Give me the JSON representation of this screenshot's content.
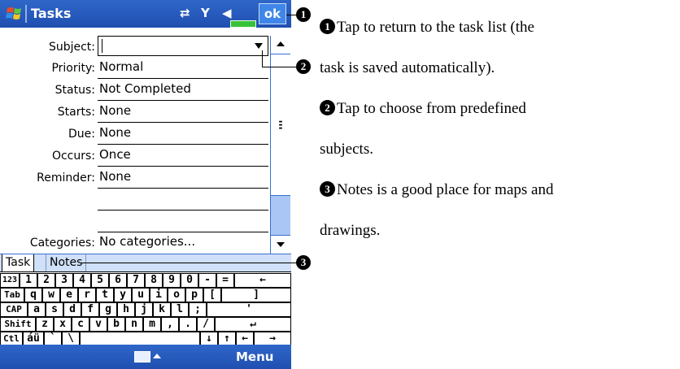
{
  "titlebar": {
    "title": "Tasks",
    "icons": [
      "connectivity-icon",
      "signal-icon",
      "speaker-icon"
    ],
    "ok_label": "ok"
  },
  "form": {
    "fields": [
      {
        "label": "Subject:",
        "value": ""
      },
      {
        "label": "Priority:",
        "value": "Normal"
      },
      {
        "label": "Status:",
        "value": "Not Completed"
      },
      {
        "label": "Starts:",
        "value": "None"
      },
      {
        "label": "Due:",
        "value": "None"
      },
      {
        "label": "Occurs:",
        "value": "Once"
      },
      {
        "label": "Reminder:",
        "value": "None"
      },
      {
        "label": "",
        "value": ""
      },
      {
        "label": "Categories:",
        "value": "No categories..."
      }
    ]
  },
  "tabs": [
    "Task",
    "Notes"
  ],
  "keyboard": {
    "rows": [
      [
        "123",
        "1",
        "2",
        "3",
        "4",
        "5",
        "6",
        "7",
        "8",
        "9",
        "0",
        "-",
        "=",
        "←"
      ],
      [
        "Tab",
        "q",
        "w",
        "e",
        "r",
        "t",
        "y",
        "u",
        "i",
        "o",
        "p",
        "[",
        "]"
      ],
      [
        "CAP",
        "a",
        "s",
        "d",
        "f",
        "g",
        "h",
        "j",
        "k",
        "l",
        ";",
        "'"
      ],
      [
        "Shift",
        "z",
        "x",
        "c",
        "v",
        "b",
        "n",
        "m",
        ",",
        ".",
        "/",
        "↵"
      ],
      [
        "Ctl",
        "áü",
        "`",
        "\\",
        " ",
        "↓",
        "↑",
        "←",
        "→"
      ]
    ]
  },
  "bottombar": {
    "menu_label": "Menu"
  },
  "callouts": {
    "1": "1",
    "2": "2",
    "3": "3"
  },
  "notes": [
    {
      "num": "1",
      "lines": [
        "Tap to return to the task list (the",
        "task is saved automatically)."
      ]
    },
    {
      "num": "2",
      "lines": [
        "Tap to choose from predefined",
        "subjects."
      ]
    },
    {
      "num": "3",
      "lines": [
        "Notes is a good place for maps and",
        "drawings."
      ]
    }
  ],
  "colors": {
    "titlebar": "#1f4fb0",
    "tab_bar": "#cfe0f8",
    "scroll_track": "#a9c6f5"
  }
}
